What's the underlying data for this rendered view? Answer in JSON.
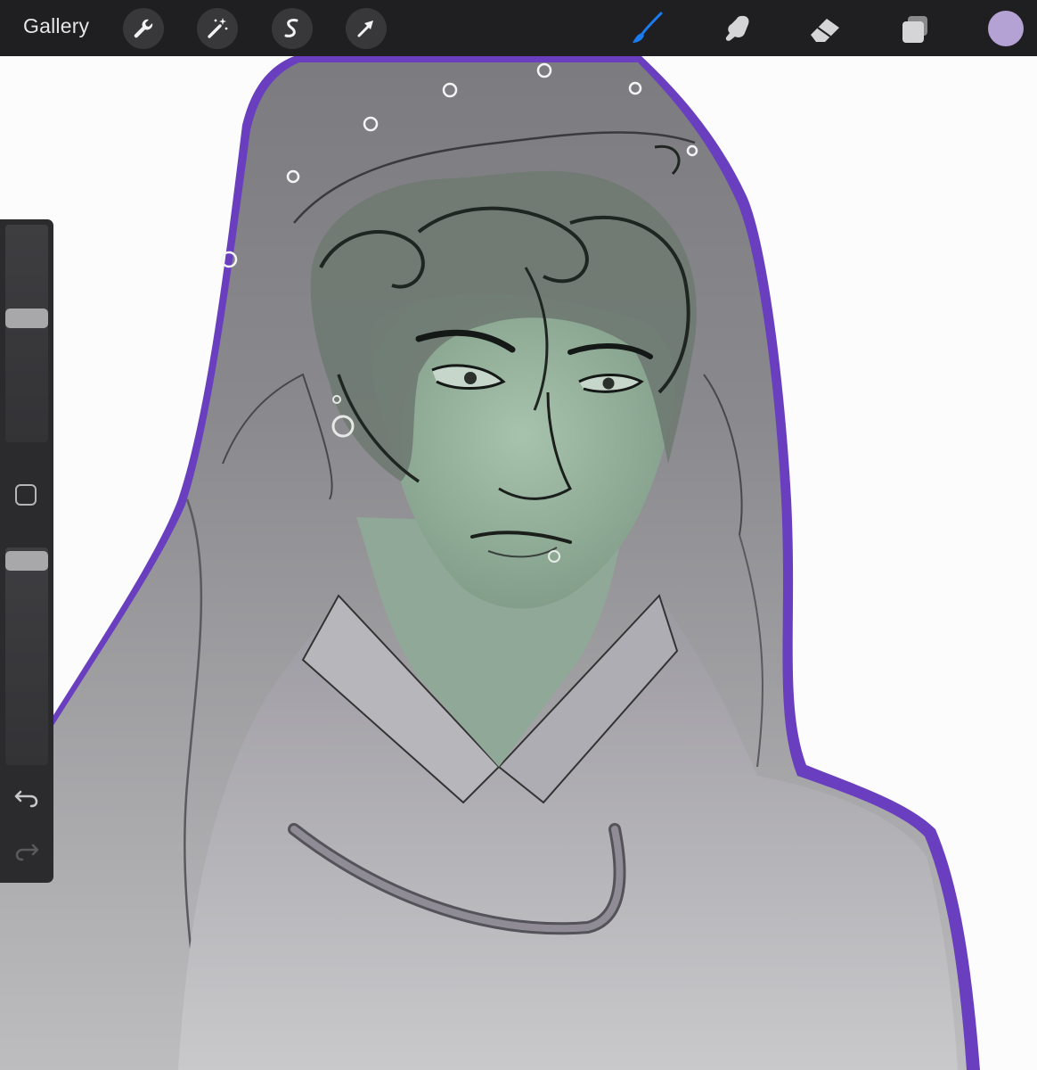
{
  "toolbar": {
    "gallery_label": "Gallery",
    "left_tools": [
      {
        "icon": "wrench-icon",
        "name": "actions"
      },
      {
        "icon": "magic-wand-icon",
        "name": "adjustments"
      },
      {
        "icon": "selection-s-icon",
        "name": "selection"
      },
      {
        "icon": "transform-arrow-icon",
        "name": "transform"
      }
    ],
    "right_tools": [
      {
        "icon": "brush-icon",
        "name": "paint",
        "active": true
      },
      {
        "icon": "smudge-icon",
        "name": "smudge"
      },
      {
        "icon": "eraser-icon",
        "name": "erase"
      },
      {
        "icon": "layers-icon",
        "name": "layers"
      }
    ],
    "current_color": "#b5a2d4"
  },
  "colors": {
    "toolbar_bg": "#1f1f21",
    "active_tool": "#1a7cf0",
    "outline": "#6a3fbf",
    "skin": "#9cb7a2",
    "veil": "#8f8f94"
  },
  "sidebar": {
    "brush_size_level": 0.58,
    "opacity_level": 1.0,
    "icons": [
      "modifier-square-icon",
      "undo-icon",
      "redo-icon"
    ]
  }
}
